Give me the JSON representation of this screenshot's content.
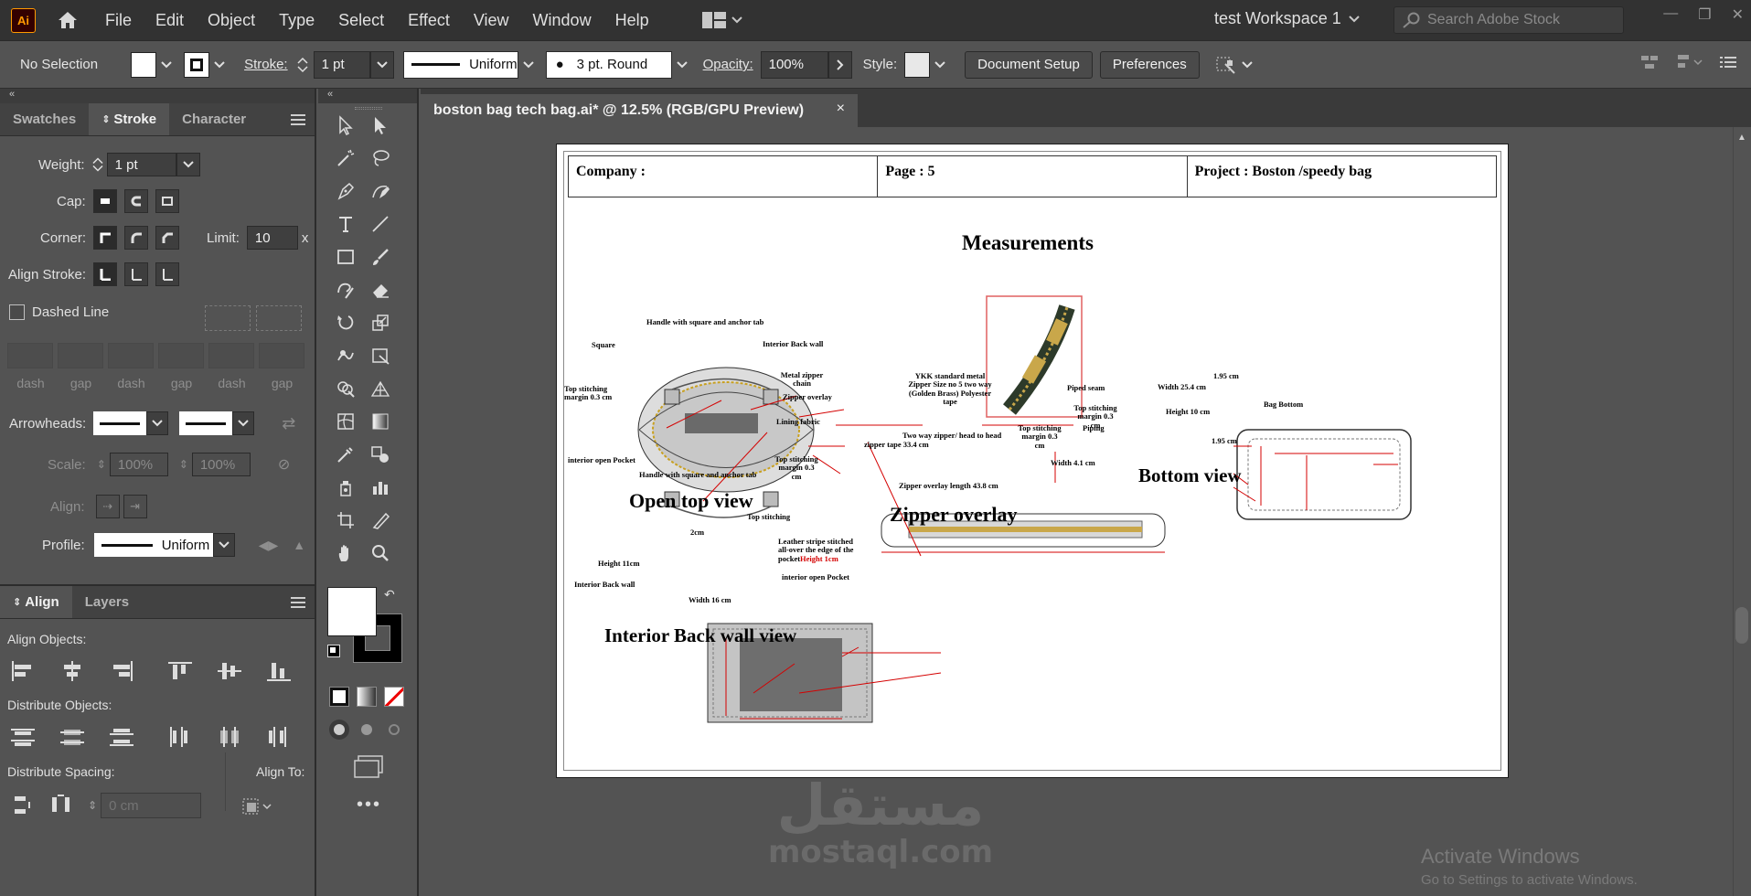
{
  "app": {
    "logo": "Ai"
  },
  "menu": [
    "File",
    "Edit",
    "Object",
    "Type",
    "Select",
    "Effect",
    "View",
    "Window",
    "Help"
  ],
  "workspace": "test Workspace 1",
  "stock_search_placeholder": "Search Adobe Stock",
  "control_bar": {
    "selection": "No Selection",
    "stroke_label": "Stroke:",
    "stroke_weight": "1 pt",
    "stroke_profile": "Uniform",
    "brush": "3 pt. Round",
    "opacity_label": "Opacity:",
    "opacity": "100%",
    "style_label": "Style:",
    "document_setup": "Document Setup",
    "preferences": "Preferences"
  },
  "stroke_panel": {
    "tabs": [
      "Swatches",
      "Stroke",
      "Character"
    ],
    "weight_label": "Weight:",
    "weight": "1 pt",
    "cap_label": "Cap:",
    "corner_label": "Corner:",
    "limit_label": "Limit:",
    "limit": "10",
    "limit_unit": "x",
    "align_stroke_label": "Align Stroke:",
    "dashed_line": "Dashed Line",
    "dash_labels": [
      "dash",
      "gap",
      "dash",
      "gap",
      "dash",
      "gap"
    ],
    "arrowheads_label": "Arrowheads:",
    "scale_label": "Scale:",
    "scale_1": "100%",
    "scale_2": "100%",
    "align_label": "Align:",
    "profile_label": "Profile:",
    "profile": "Uniform"
  },
  "align_panel": {
    "tabs": [
      "Align",
      "Layers"
    ],
    "align_objects": "Align Objects:",
    "distribute_objects": "Distribute Objects:",
    "distribute_spacing": "Distribute Spacing:",
    "align_to": "Align To:",
    "spacing_value": "0 cm"
  },
  "document": {
    "tab_title": "boston bag tech bag.ai* @ 12.5% (RGB/GPU Preview)",
    "close": "×"
  },
  "artboard": {
    "company": "Company :",
    "page": "Page : 5",
    "project": "Project : Boston /speedy bag",
    "title": "Measurements",
    "open_top_view": "Open  top view",
    "zipper_overlay": "Zipper overlay",
    "bottom_view": "Bottom view",
    "interior_back_wall_view": "Interior Back wall view",
    "labels": {
      "handle_top": "Handle with square and anchor tab",
      "handle_bottom": "Handle with square and anchor tab",
      "square": "Square",
      "interior_back_wall": "Interior Back wall",
      "top_stitching_1": "Top stitching margin 0.3 cm",
      "metal_zipper_chain": "Metal zipper chain",
      "zipper_overlay_lbl": "Zipper overlay",
      "lining_fabric": "Lining fabric",
      "interior_open_pocket": "interior open Pocket",
      "ykk": "YKK standard metal Zipper Size no 5 two way (Golden Brass) Polyester tape",
      "two_way_zipper": "Two way zipper/ head to head",
      "zipper_tape": "zipper tape 33.4 cm",
      "top_stitching_2": "Top stitching margin 0.3 cm",
      "top_stitching_3": "Top stitching margin 0.3 cm",
      "width_41": "Width 4.1 cm",
      "zipper_overlay_length": "Zipper overlay length 43.8 cm",
      "piped_seam": "Piped seam",
      "top_stitching_4": "Top stitching margin 0.3 cm",
      "piping": "Piping",
      "width_254": "Width 25.4 cm",
      "height_10": "Height 10 cm",
      "bag_bottom": "Bag Bottom",
      "dim_195_top": "1.95 cm",
      "dim_195_bottom": "1.95 cm",
      "top_stitching_5": "Top stitching",
      "dim_2cm": "2cm",
      "height_11": "Height 11cm",
      "interior_back_wall_2": "Interior Back wall",
      "leather_stripe": "Leather stripe stitched all-over the edge of the pocket",
      "height_1cm": "Height 1cm",
      "interior_open_pocket_2": "interior open Pocket",
      "width_16": "Width 16 cm"
    }
  },
  "watermark": {
    "arabic": "مستقل",
    "latin": "mostaql.com"
  },
  "activate": {
    "title": "Activate Windows",
    "subtitle": "Go to Settings to activate Windows."
  }
}
